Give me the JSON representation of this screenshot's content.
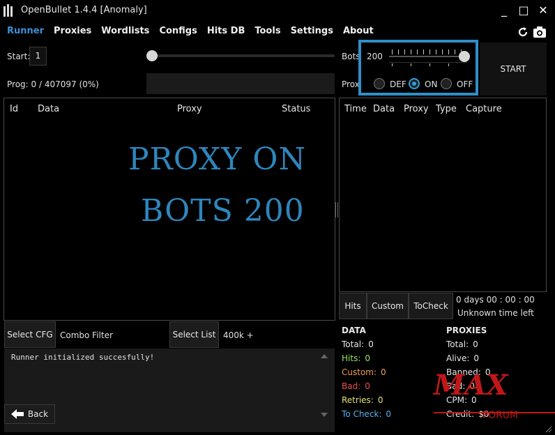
{
  "window": {
    "title": "OpenBullet 1.4.4 [Anomaly]",
    "minimize": "_",
    "maximize": "□",
    "close": "✕"
  },
  "menu": [
    {
      "label": "Runner",
      "active": true
    },
    {
      "label": "Proxies"
    },
    {
      "label": "Wordlists"
    },
    {
      "label": "Configs"
    },
    {
      "label": "Hits DB"
    },
    {
      "label": "Tools"
    },
    {
      "label": "Settings"
    },
    {
      "label": "About"
    }
  ],
  "controls": {
    "start_label": "Start:",
    "start_value": "1",
    "prog_label": "Prog: 0 / 407097 (0%)",
    "bots_label": "Bots",
    "bots_value": "200",
    "bots_slider_level": 1.0,
    "proxy_label": "Prox",
    "proxy_options": [
      "DEF",
      "ON",
      "OFF"
    ],
    "proxy_selected": "ON",
    "start_button": "START"
  },
  "runner_table": {
    "columns": [
      "Id",
      "Data",
      "Proxy",
      "Status"
    ],
    "overlay_line1": "PROXY  ON",
    "overlay_line2": "BOTS  200"
  },
  "hits_table": {
    "columns": [
      "Time",
      "Data",
      "Proxy",
      "Type",
      "Capture"
    ]
  },
  "tabs": [
    "Hits",
    "Custom",
    "ToCheck"
  ],
  "timer": {
    "elapsed": "0  days 00 : 00 : 00",
    "remaining": "Unknown time left"
  },
  "bottom": {
    "select_cfg": "Select CFG",
    "combo_filter": "Combo Filter",
    "select_list": "Select List",
    "list_name": "400k +",
    "log_line": "Runner initialized succesfully!",
    "back": "Back"
  },
  "data_stats": {
    "title": "DATA",
    "rows": [
      {
        "label": "Total:",
        "value": "0",
        "color": "#e8e8e8"
      },
      {
        "label": "Hits:",
        "value": "0",
        "color": "#9be36a"
      },
      {
        "label": "Custom:",
        "value": "0",
        "color": "#f0a050"
      },
      {
        "label": "Bad:",
        "value": "0",
        "color": "#e85050"
      },
      {
        "label": "Retries:",
        "value": "0",
        "color": "#e8e070"
      },
      {
        "label": "To Check:",
        "value": "0",
        "color": "#5ab0f0"
      }
    ]
  },
  "proxy_stats": {
    "title": "PROXIES",
    "rows": [
      {
        "label": "Total:",
        "value": "0"
      },
      {
        "label": "Alive:",
        "value": "0"
      },
      {
        "label": "Banned:",
        "value": "0"
      },
      {
        "label": "Bad:",
        "value": "0"
      },
      {
        "label": "CPM:",
        "value": "0"
      },
      {
        "label": "Credit:",
        "value": "$0"
      }
    ]
  },
  "watermark": {
    "text": "MAX",
    "sub": "FORUM"
  },
  "colors": {
    "accent": "#2f8fc7",
    "overlay": "#2e86bd",
    "watermark": "#c01818"
  }
}
